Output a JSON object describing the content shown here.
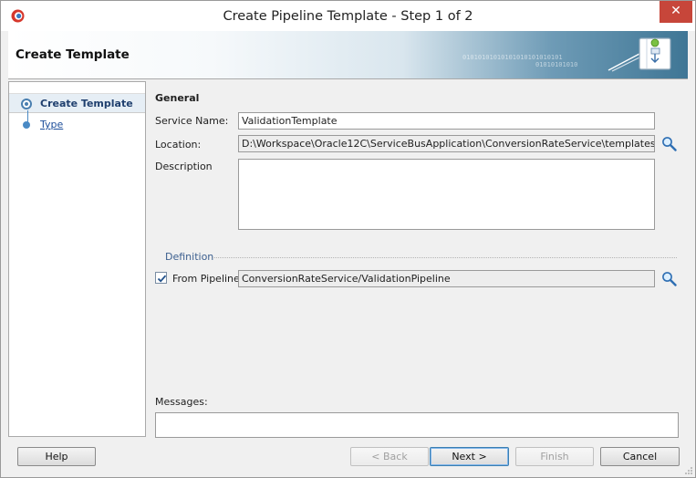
{
  "window": {
    "title": "Create Pipeline Template - Step 1 of 2",
    "close_glyph": "✕"
  },
  "banner": {
    "title": "Create Template",
    "binary_text": "01010101010101010101010101",
    "binary_text2": "01010101010"
  },
  "nav": {
    "items": [
      {
        "label": "Create Template",
        "state": "current"
      },
      {
        "label": "Type",
        "state": "link"
      }
    ]
  },
  "general": {
    "section_title": "General",
    "service_name_label": "Service Name:",
    "service_name_value": "ValidationTemplate",
    "location_label": "Location:",
    "location_value": "D:\\Workspace\\Oracle12C\\ServiceBusApplication\\ConversionRateService\\templates",
    "description_label": "Description",
    "description_value": ""
  },
  "definition": {
    "legend": "Definition",
    "from_pipeline_label": "From Pipeline",
    "from_pipeline_checked": true,
    "pipeline_value": "ConversionRateService/ValidationPipeline"
  },
  "messages": {
    "label": "Messages:",
    "value": ""
  },
  "buttons": {
    "help": "Help",
    "back": "< Back",
    "next": "Next >",
    "finish": "Finish",
    "cancel": "Cancel"
  },
  "colors": {
    "close_button": "#c7463a",
    "accent": "#1f3f6e",
    "link": "#1d4e9a"
  }
}
